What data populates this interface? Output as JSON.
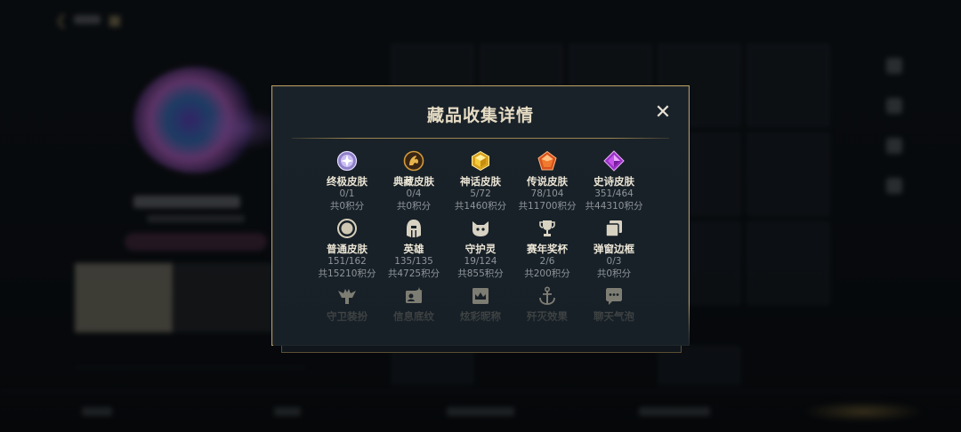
{
  "modal": {
    "title": "藏品收集详情",
    "close_glyph": "✕"
  },
  "categories": [
    {
      "name": "终极皮肤",
      "count": "0/1",
      "points": "共0积分",
      "icon": "ultimate-gem-icon",
      "color": "#b7a6e0"
    },
    {
      "name": "典藏皮肤",
      "count": "0/4",
      "points": "共0积分",
      "icon": "legendary-horse-emblem-icon",
      "color": "#d49a3a"
    },
    {
      "name": "神话皮肤",
      "count": "5/72",
      "points": "共1460积分",
      "icon": "mythic-gold-gem-icon",
      "color": "#e0b224"
    },
    {
      "name": "传说皮肤",
      "count": "78/104",
      "points": "共11700积分",
      "icon": "legend-orange-gem-icon",
      "color": "#e0642a"
    },
    {
      "name": "史诗皮肤",
      "count": "351/464",
      "points": "共44310积分",
      "icon": "epic-purple-gem-icon",
      "color": "#b348d8"
    },
    {
      "name": "普通皮肤",
      "count": "151/162",
      "points": "共15210积分",
      "icon": "normal-ring-icon",
      "color": "#cfc7b2"
    },
    {
      "name": "英雄",
      "count": "135/135",
      "points": "共4725积分",
      "icon": "hero-helmet-icon",
      "color": "#d8d2c2"
    },
    {
      "name": "守护灵",
      "count": "19/124",
      "points": "共855积分",
      "icon": "guardian-cat-icon",
      "color": "#d8d2c2"
    },
    {
      "name": "赛年奖杯",
      "count": "2/6",
      "points": "共200积分",
      "icon": "trophy-icon",
      "color": "#d8d2c2"
    },
    {
      "name": "弹窗边框",
      "count": "0/3",
      "points": "共0积分",
      "icon": "popup-frame-icon",
      "color": "#d8d2c2"
    },
    {
      "name": "守卫装扮",
      "icon": "ward-skin-icon",
      "color": "#9a9585"
    },
    {
      "name": "信息底纹",
      "icon": "info-card-icon",
      "color": "#9a9585"
    },
    {
      "name": "炫彩昵称",
      "icon": "nickname-crown-icon",
      "color": "#9a9585"
    },
    {
      "name": "歼灭效果",
      "icon": "anchor-effect-icon",
      "color": "#9a9585"
    },
    {
      "name": "聊天气泡",
      "icon": "chat-bubble-icon",
      "color": "#9a9585"
    }
  ]
}
